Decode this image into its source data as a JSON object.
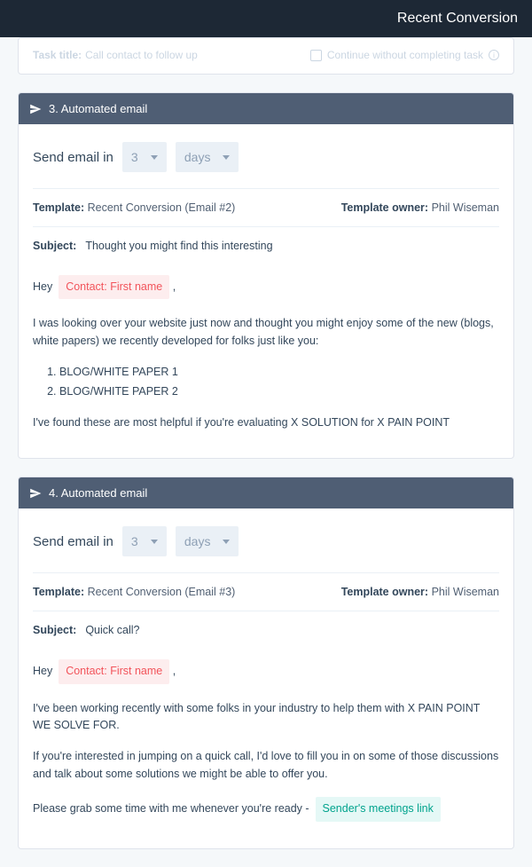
{
  "topbar": {
    "title": "Recent Conversion"
  },
  "task": {
    "title_label": "Task title:",
    "title_value": "Call contact to follow up",
    "continue_label": "Continue without completing task"
  },
  "step3": {
    "header": "3. Automated email",
    "send_label": "Send email in",
    "num": "3",
    "unit": "days",
    "template_label": "Template:",
    "template_value": "Recent Conversion (Email #2)",
    "owner_label": "Template owner:",
    "owner_value": "Phil Wiseman",
    "subject_label": "Subject:",
    "subject_value": "Thought you might find this interesting",
    "greeting": "Hey",
    "token": "Contact: First name",
    "comma": ",",
    "p1": "I was looking over your website just now and thought you might enjoy some of the new (blogs, white papers) we recently developed for folks just like you:",
    "li1": "BLOG/WHITE PAPER 1",
    "li2": "BLOG/WHITE PAPER 2",
    "p2": "I've found these are most helpful if you're evaluating X SOLUTION for X PAIN POINT"
  },
  "step4": {
    "header": "4. Automated email",
    "send_label": "Send email in",
    "num": "3",
    "unit": "days",
    "template_label": "Template:",
    "template_value": "Recent Conversion (Email #3)",
    "owner_label": "Template owner:",
    "owner_value": "Phil Wiseman",
    "subject_label": "Subject:",
    "subject_value": "Quick call?",
    "greeting": "Hey",
    "token": "Contact: First name",
    "comma": ",",
    "p1": "I've been working recently with some folks in your industry to help them with X PAIN POINT WE SOLVE FOR.",
    "p2": "If you're interested in jumping on a quick call, I'd love to fill you in on some of those discussions and talk about some solutions we might be able to offer you.",
    "p3": "Please grab some time with me whenever you're ready -",
    "meeting_token": "Sender's meetings link"
  }
}
